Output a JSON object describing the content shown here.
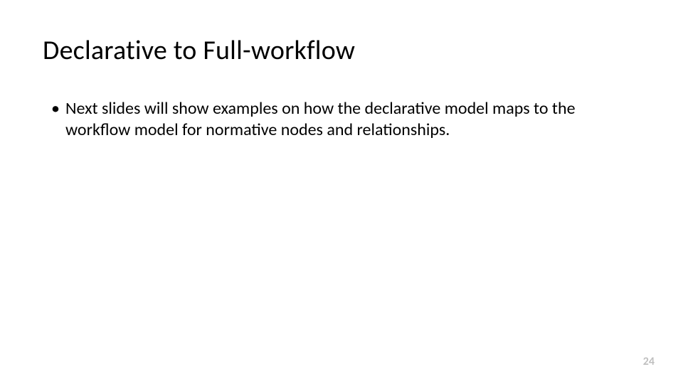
{
  "slide": {
    "title": "Declarative to Full-workflow",
    "bullets": [
      "Next slides will show examples on how the declarative model maps to the workflow model for normative nodes and relationships."
    ],
    "page_number": "24"
  }
}
